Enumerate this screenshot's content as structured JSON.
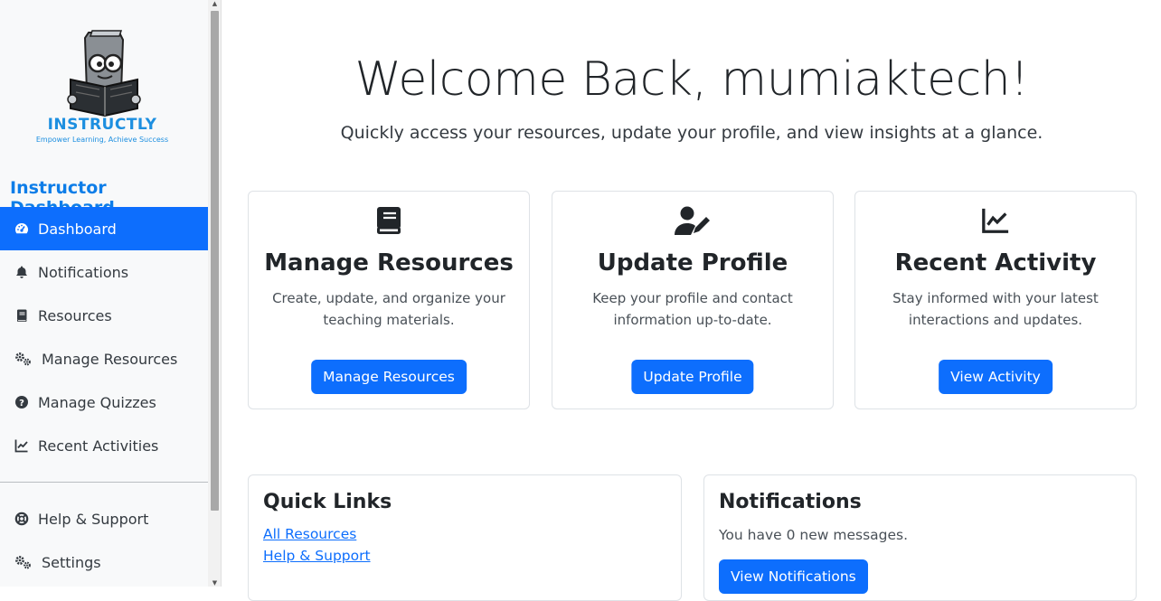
{
  "brand": {
    "name": "INSTRUCTLY",
    "tagline": "Empower Learning, Achieve Success"
  },
  "sidebar": {
    "title": "Instructor Dashboard",
    "items": [
      {
        "label": "Dashboard",
        "icon": "gauge-icon",
        "active": true
      },
      {
        "label": "Notifications",
        "icon": "bell-icon"
      },
      {
        "label": "Resources",
        "icon": "book-icon"
      },
      {
        "label": "Manage Resources",
        "icon": "gears-icon"
      },
      {
        "label": "Manage Quizzes",
        "icon": "question-circle-icon"
      },
      {
        "label": "Recent Activities",
        "icon": "chart-line-icon"
      }
    ],
    "bottom_items": [
      {
        "label": "Help & Support",
        "icon": "life-ring-icon"
      },
      {
        "label": "Settings",
        "icon": "gears-icon"
      }
    ]
  },
  "header": {
    "welcome": "Welcome Back, mumiaktech!",
    "subtitle": "Quickly access your resources, update your profile, and view insights at a glance."
  },
  "cards": [
    {
      "title": "Manage Resources",
      "text": "Create, update, and organize your teaching materials.",
      "button": "Manage Resources",
      "icon": "book-icon"
    },
    {
      "title": "Update Profile",
      "text": "Keep your profile and contact information up-to-date.",
      "button": "Update Profile",
      "icon": "user-pen-icon"
    },
    {
      "title": "Recent Activity",
      "text": "Stay informed with your latest interactions and updates.",
      "button": "View Activity",
      "icon": "chart-line-icon"
    }
  ],
  "quick_links": {
    "title": "Quick Links",
    "links": [
      "All Resources",
      "Help & Support"
    ]
  },
  "notifications": {
    "title": "Notifications",
    "message": "You have 0 new messages.",
    "button": "View Notifications"
  },
  "colors": {
    "primary": "#0d6efd",
    "brand": "#1d8fe0",
    "sidebar_bg": "#f8f9fa"
  }
}
